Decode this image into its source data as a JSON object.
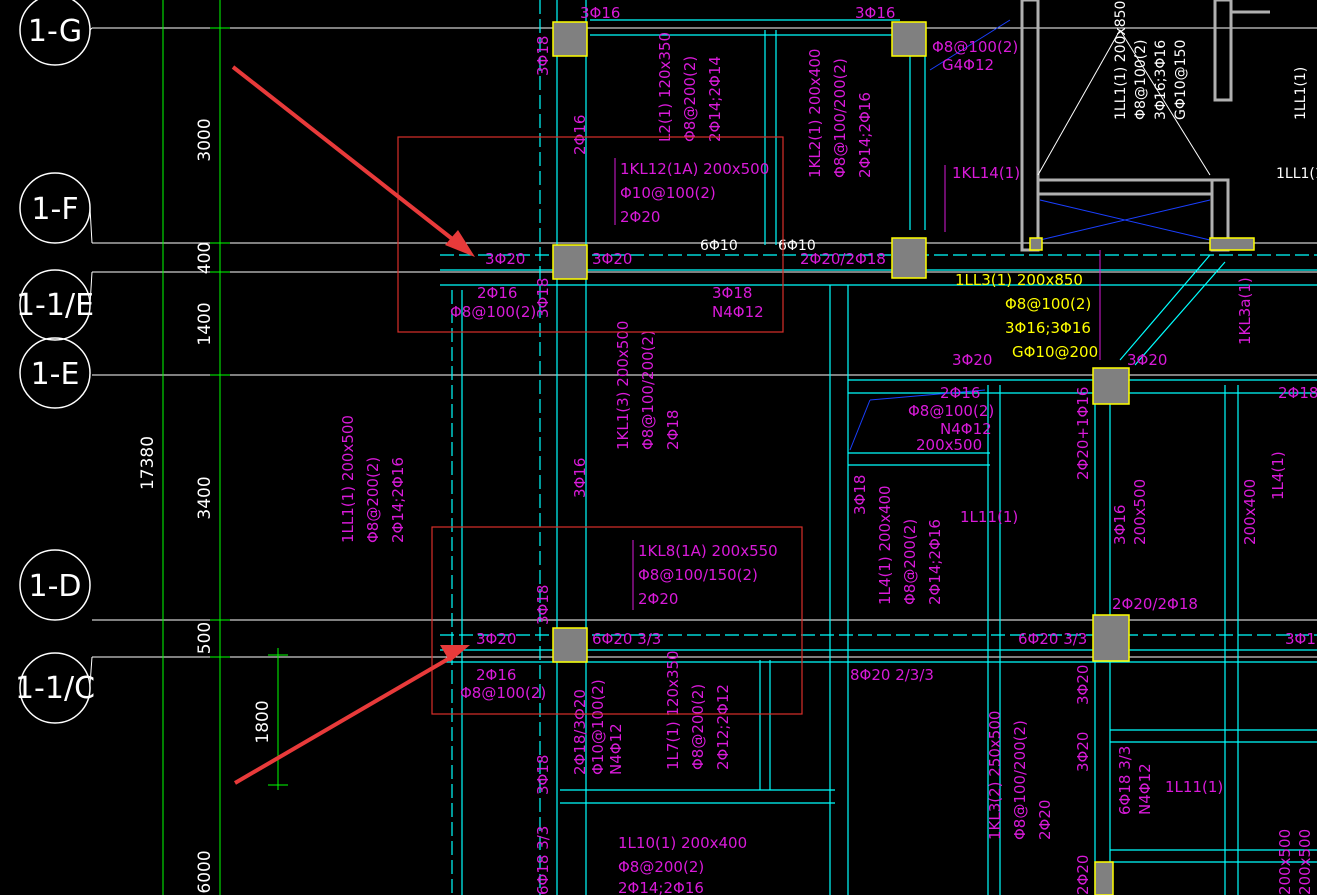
{
  "grid_axes": [
    {
      "id": "1-G",
      "label": "1-G"
    },
    {
      "id": "1-F",
      "label": "1-F"
    },
    {
      "id": "1-1/E",
      "label": "1-1/E"
    },
    {
      "id": "1-E",
      "label": "1-E"
    },
    {
      "id": "1-D",
      "label": "1-D"
    },
    {
      "id": "1-1/C",
      "label": "1-1/C"
    }
  ],
  "dimensions": {
    "d3000": "3000",
    "d400": "400",
    "d1400": "1400",
    "d3400": "3400",
    "d500": "500",
    "d1800": "1800",
    "d6000": "6000",
    "total": "17380"
  },
  "beams": {
    "kl12": [
      "1KL12(1A) 200x500",
      "Φ10@100(2)",
      "2Φ20"
    ],
    "kl8": [
      "1KL8(1A) 200x550",
      "Φ8@100/150(2)",
      "2Φ20"
    ],
    "ll3": [
      "1LL3(1) 200x850",
      "Φ8@100(2)",
      "3Φ16;3Φ16",
      "GΦ10@200"
    ],
    "ll1_right": [
      "1LL1(1) 200x850",
      "Φ8@100(2)",
      "3Φ16;3Φ16",
      "GΦ10@150"
    ],
    "kl2": [
      "1KL2(1) 200x400",
      "Φ8@100/200(2)",
      "2Φ14;2Φ16"
    ],
    "l2": [
      "L2(1) 120x350",
      "Φ8@200(2)",
      "2Φ14;2Φ14"
    ],
    "kl1": [
      "1KL1(3) 200x500",
      "Φ8@100/200(2)",
      "2Φ18"
    ],
    "ll1": [
      "1LL1(1) 200x500",
      "Φ8@200(2)",
      "2Φ14;2Φ16"
    ],
    "l4": [
      "1L4(1) 200x400",
      "Φ8@200(2)",
      "2Φ14;2Φ16"
    ],
    "l7": [
      "1L7(1) 120x350",
      "Φ8@200(2)",
      "2Φ12;2Φ12"
    ],
    "l10": [
      "1L10(1) 200x400",
      "Φ8@200(2)",
      "2Φ14;2Φ16"
    ],
    "kl3": [
      "1KL3(2) 250x500",
      "Φ8@100/200(2)",
      "2Φ20"
    ],
    "kl3a": "1KL3a(1)",
    "kl14": "1KL14(1)",
    "l11": "1L11(1)",
    "l11b": "1L11(1)",
    "l14": "1L4(1)",
    "ll1_cut": "1LL1(1",
    "ll_cut": "1LL1(1)",
    "kl3_cut": "200x500"
  },
  "labels": {
    "t_3f16_a": "3Φ16",
    "t_3f16_b": "3Φ16",
    "t_3f18_a": "3Φ18",
    "t_2f16_a": "2Φ16",
    "t_f8_g4": "Φ8@100(2)",
    "t_g4f12": "G4Φ12",
    "t_3f20_a": "3Φ20",
    "t_3f20_b": "3Φ20",
    "t_6f10_a": "6Φ10",
    "t_6f10_b": "6Φ10",
    "t_2f20_2f18": "2Φ20/2Φ18",
    "t_2f16_b": "2Φ16",
    "t_f8_b": "Φ8@100(2)",
    "t_3f18_b": "3Φ18",
    "t_3f18_c": "3Φ18",
    "t_n4f12": "N4Φ12",
    "t_3f20_c": "3Φ20",
    "t_3f20_d": "3Φ20",
    "t_2f16_c": "2Φ16",
    "t_f8_c": "Φ8@100(2)",
    "t_n4f12_b": "N4Φ12",
    "t_200x500": "200x500",
    "t_2f18": "2Φ18",
    "t_3f16_c": "3Φ16",
    "t_3f18_d": "3Φ18",
    "t_2f20_1f16": "2Φ20+1Φ16",
    "t_3f16_d": "3Φ16",
    "t_200x500_b": "200x500",
    "t_200x400": "200x400",
    "t_3f18_e": "3Φ18",
    "t_3f20_e": "3Φ20",
    "t_6f20": "6Φ20 3/3",
    "t_6f20_b": "6Φ20 3/3",
    "t_2f20_2f18_b": "2Φ20/2Φ18",
    "t_3f18_f": "3Φ18",
    "t_2f16_d": "2Φ16",
    "t_f8_d": "Φ8@100(2)",
    "t_8f20": "8Φ20 2/3/3",
    "t_2f18_3f20": "2Φ18/3Φ20",
    "t_f10": "Φ10@100(2)",
    "t_n4f12_c": "N4Φ12",
    "t_3f18_g": "3Φ18",
    "t_3f20_f": "3Φ20",
    "t_3f20_g": "3Φ20",
    "t_6f18": "6Φ18 3/3",
    "t_n4f12_d": "N4Φ12",
    "t_6f18_b": "6Φ18 3/3",
    "t_2f20_b": "2Φ20",
    "t_200x500_c": "200x500"
  },
  "colors": {
    "background": "#000000",
    "grid": "#ffffff",
    "dimension": "#00ff00",
    "beam_lines": "#00ffff",
    "annotation": "#d91ad9",
    "yellow_text": "#ffff00",
    "column": "#808080",
    "highlight_box": "#d9302a",
    "arrow": "#e83a3a",
    "blue": "#1a3fff",
    "wall": "#b0b0b0"
  }
}
